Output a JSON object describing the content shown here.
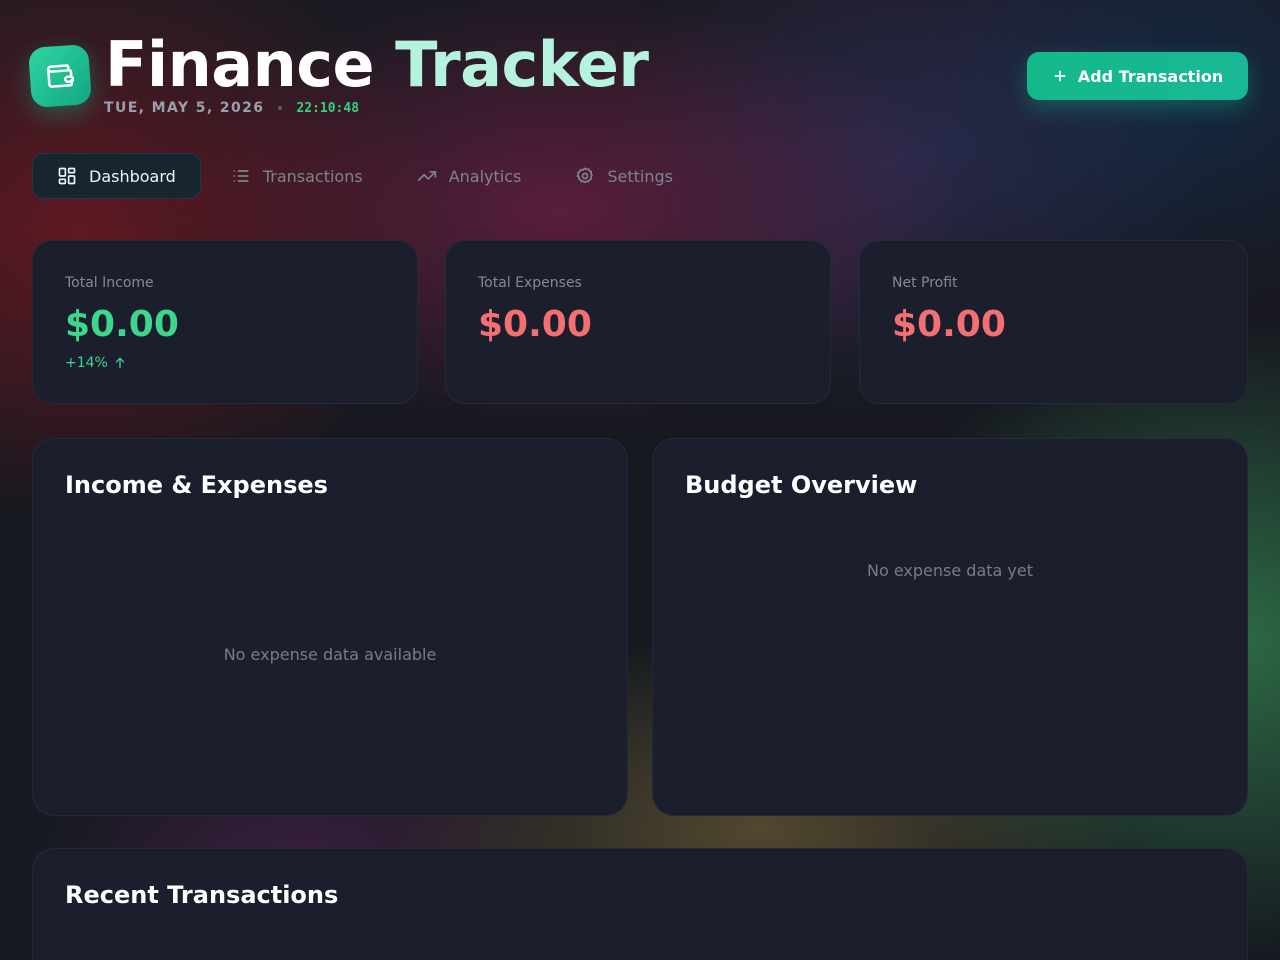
{
  "header": {
    "title_part1": "Finance",
    "title_part2": "Tracker",
    "date": "TUE, MAY 5, 2026",
    "time": "22:10:48",
    "logo_icon": "wallet-icon",
    "add_button": {
      "label": "Add Transaction",
      "icon": "plus-icon"
    }
  },
  "nav": {
    "tabs": [
      {
        "label": "Dashboard",
        "icon": "grid-icon",
        "active": true
      },
      {
        "label": "Transactions",
        "icon": "list-icon",
        "active": false
      },
      {
        "label": "Analytics",
        "icon": "trending-up-icon",
        "active": false
      },
      {
        "label": "Settings",
        "icon": "gear-icon",
        "active": false
      }
    ]
  },
  "stats": {
    "income": {
      "label": "Total Income",
      "value": "$0.00",
      "change": "+14%",
      "change_icon": "arrow-up-icon"
    },
    "expenses": {
      "label": "Total Expenses",
      "value": "$0.00"
    },
    "profit": {
      "label": "Net Profit",
      "value": "$0.00"
    }
  },
  "panels": {
    "income_expenses": {
      "title": "Income & Expenses",
      "empty": "No expense data available"
    },
    "budget": {
      "title": "Budget Overview",
      "empty": "No expense data yet"
    },
    "recent": {
      "title": "Recent Transactions"
    }
  },
  "colors": {
    "accent": "#14b98a",
    "income_green": "#3dd68c",
    "expense_red": "#f26f72",
    "card_bg": "#1b1f2d"
  }
}
